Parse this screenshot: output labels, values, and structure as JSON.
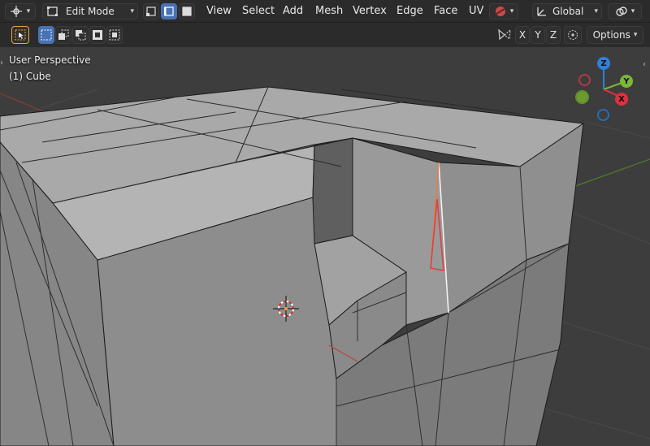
{
  "header": {
    "mode": {
      "label": "Edit Mode",
      "icon": "edit-mode-icon"
    },
    "select_modes": [
      "vertex-select-icon",
      "edge-select-icon",
      "face-select-icon"
    ],
    "menus": [
      "View",
      "Select",
      "Add",
      "Mesh",
      "Vertex",
      "Edge",
      "Face",
      "UV"
    ],
    "transform_orientation": "Global"
  },
  "toolbar": {
    "axes": [
      "X",
      "Y",
      "Z"
    ],
    "options_label": "Options"
  },
  "viewport": {
    "view_name": "User Perspective",
    "object_name": "(1) Cube"
  },
  "gizmo": {
    "z_label": "Z",
    "y_label": "Y",
    "x_label": "X",
    "colors": {
      "x": "#e0303f",
      "y": "#7ab836",
      "z": "#2f80d8"
    }
  },
  "colors": {
    "header_bg": "#2b2b2b",
    "viewport_bg": "#3d3d3d",
    "accent": "#4772b3",
    "selected_edge": "#f07a3c",
    "selected_edge_red": "#e04040"
  }
}
